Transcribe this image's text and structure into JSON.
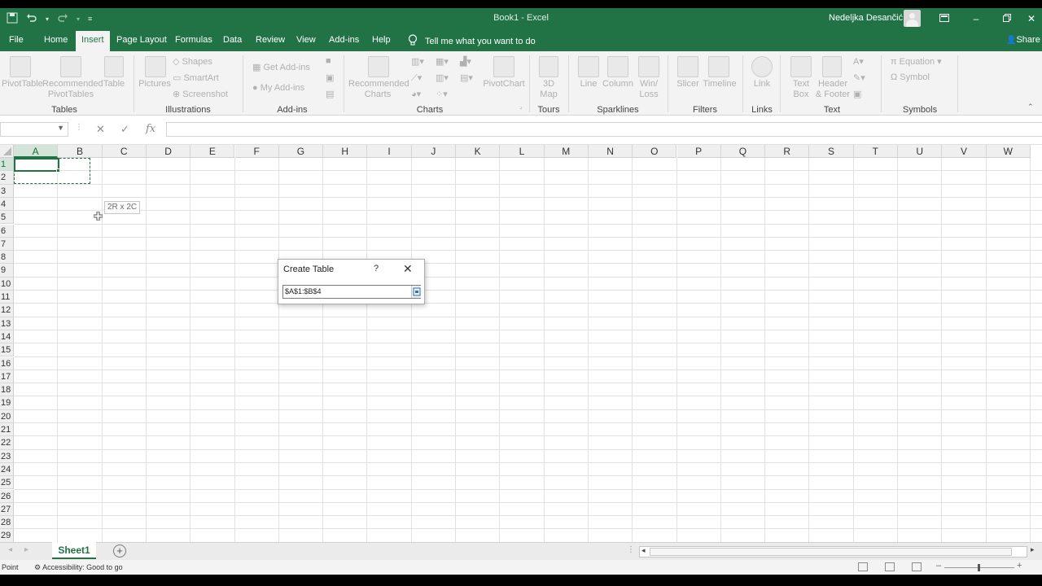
{
  "window": {
    "title": "Book1  -  Excel",
    "user": "Nedeljka Desančić"
  },
  "menu": {
    "tabs": [
      "File",
      "Home",
      "Insert",
      "Page Layout",
      "Formulas",
      "Data",
      "Review",
      "View",
      "Add-ins",
      "Help"
    ],
    "active": "Insert",
    "tell_me": "Tell me what you want to do",
    "share": "Share"
  },
  "ribbon": {
    "tables": {
      "pivottable": "PivotTable",
      "recommended_pivot_1": "Recommended",
      "recommended_pivot_2": "PivotTables",
      "table": "Table",
      "label": "Tables"
    },
    "illustrations": {
      "pictures": "Pictures",
      "shapes": "Shapes",
      "smartart": "SmartArt",
      "screenshot": "Screenshot",
      "label": "Illustrations"
    },
    "addins": {
      "get": "Get Add-ins",
      "my": "My Add-ins",
      "label": "Add-ins"
    },
    "charts": {
      "recommended_1": "Recommended",
      "recommended_2": "Charts",
      "pivotchart": "PivotChart",
      "label": "Charts"
    },
    "tours": {
      "map_1": "3D",
      "map_2": "Map",
      "label": "Tours"
    },
    "sparklines": {
      "line": "Line",
      "column": "Column",
      "winloss_1": "Win/",
      "winloss_2": "Loss",
      "label": "Sparklines"
    },
    "filters": {
      "slicer": "Slicer",
      "timeline": "Timeline",
      "label": "Filters"
    },
    "links": {
      "link": "Link",
      "label": "Links"
    },
    "text": {
      "textbox_1": "Text",
      "textbox_2": "Box",
      "header_1": "Header",
      "header_2": "& Footer",
      "label": "Text"
    },
    "symbols": {
      "equation": "Equation",
      "symbol": "Symbol",
      "label": "Symbols"
    }
  },
  "formula_bar": {
    "name_box": "",
    "formula": "",
    "fx": "fx"
  },
  "grid": {
    "columns": [
      "A",
      "B",
      "C",
      "D",
      "E",
      "F",
      "G",
      "H",
      "I",
      "J",
      "K",
      "L",
      "M",
      "N",
      "O",
      "P",
      "Q",
      "R",
      "S",
      "T",
      "U",
      "V",
      "W"
    ],
    "rows": [
      "1",
      "2",
      "3",
      "4",
      "5",
      "6",
      "7",
      "8",
      "9",
      "10",
      "11",
      "12",
      "13",
      "14",
      "15",
      "16",
      "17",
      "18",
      "19",
      "20",
      "21",
      "22",
      "23",
      "24",
      "25",
      "26",
      "27",
      "28",
      "29"
    ],
    "selected_columns": [
      "A"
    ],
    "selected_rows": [
      "1"
    ],
    "size_tooltip": "2R x 2C"
  },
  "dialog": {
    "title": "Create Table",
    "help": "?",
    "range_value": "$A$1:$B$4"
  },
  "sheets": {
    "tabs": [
      "Sheet1"
    ],
    "active": "Sheet1"
  },
  "status": {
    "mode": "Point",
    "accessibility": "Accessibility: Good to go"
  },
  "colors": {
    "excel_green": "#217346",
    "ribbon_bg": "#f3f3f3"
  }
}
